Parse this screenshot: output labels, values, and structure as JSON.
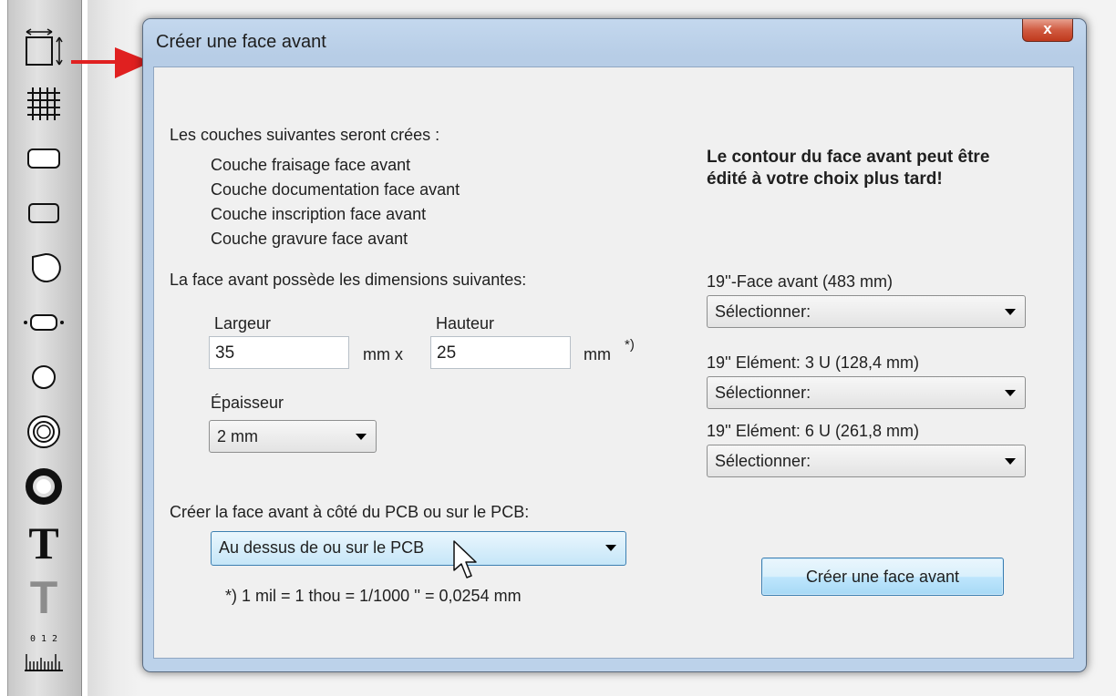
{
  "toolbar": {
    "tools": [
      "front-panel-tool-icon",
      "grid-icon",
      "rounded-rect-icon",
      "rect-pad-icon",
      "round-pad-icon",
      "oval-pad-icon",
      "circle-icon",
      "ring-icon",
      "thick-ring-icon",
      "text-bold-icon",
      "text-gray-icon",
      "ruler-icon"
    ],
    "ruler_numbers": "0  1  2"
  },
  "dialog": {
    "title": "Créer une face avant",
    "close_label": "x",
    "layers_intro": "Les couches suivantes seront crées :",
    "layers": [
      "Couche fraisage face avant",
      "Couche documentation face avant",
      "Couche inscription face avant",
      "Couche gravure face avant"
    ],
    "note_bold": "Le contour du face avant peut être édité à votre choix plus tard!",
    "dimensions_intro": "La face avant possède les dimensions suivantes:",
    "width_label": "Largeur",
    "width_value": "35",
    "unit_x": "mm  x",
    "height_label": "Hauteur",
    "height_value": "25",
    "unit_mm": "mm",
    "footnote_mark": "*)",
    "thickness_label": "Épaisseur",
    "thickness_value": "2 mm",
    "placement_label": "Créer la face avant à côté du PCB ou sur le PCB:",
    "placement_value": "Au dessus de ou sur le PCB",
    "footnote": "*)  1 mil  =  1 thou  =  1/1000 ''  =  0,0254 mm",
    "preset1_label": "19''-Face avant (483 mm)",
    "preset1_value": "Sélectionner:",
    "preset2_label": "19'' Elément: 3 U (128,4 mm)",
    "preset2_value": "Sélectionner:",
    "preset3_label": "19'' Elément: 6 U (261,8 mm)",
    "preset3_value": "Sélectionner:",
    "create_button": "Créer une face avant"
  },
  "colors": {
    "arrow": "#e02020",
    "title_bar": "#bcd2ea",
    "close_button": "#c8452a"
  }
}
